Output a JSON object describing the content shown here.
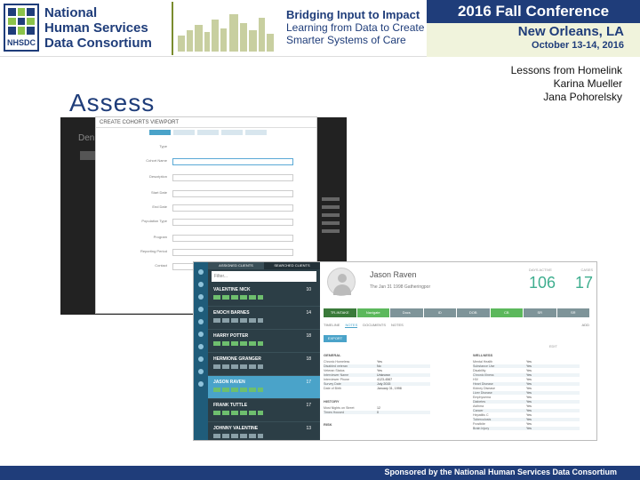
{
  "header": {
    "org_line1": "National",
    "org_line2": "Human Services",
    "org_line3": "Data Consortium",
    "logo_abbr": "NHSDC",
    "theme_title": "Bridging Input to Impact",
    "theme_line2": "Learning from Data to Create",
    "theme_line3": "Smarter Systems of Care",
    "conference": "2016 Fall Conference",
    "location": "New Orleans, LA",
    "dates": "October 13-14, 2016"
  },
  "slide": {
    "title": "Assess",
    "subtitle": "Lessons from Homelink",
    "author1": "Karina Mueller",
    "author2": "Jana Pohorelsky"
  },
  "footer": {
    "text": "Sponsored by the National Human Services Data Consortium"
  },
  "bg_screenshot": {
    "heading": "Den"
  },
  "form": {
    "title": "CREATE COHORTS VIEWPORT",
    "fields": [
      {
        "label": "Type"
      },
      {
        "label": "Cohort Name"
      },
      {
        "label": "Description"
      },
      {
        "label": "Start Date"
      },
      {
        "label": "End Date"
      },
      {
        "label": "Population Type"
      },
      {
        "label": "Program"
      },
      {
        "label": "Reporting Period"
      },
      {
        "label": "Contact"
      }
    ]
  },
  "app": {
    "list_tabs": [
      "ASSIGNED CLIENTS",
      "SEARCHED CLIENTS"
    ],
    "filter_placeholder": "Filter...",
    "clients": [
      {
        "name": "VALENTINE NICK",
        "age": "10"
      },
      {
        "name": "ENOCH BARNES",
        "age": "14"
      },
      {
        "name": "HARRY POTTER",
        "age": "18"
      },
      {
        "name": "HERMIONE GRANGER",
        "age": "18"
      },
      {
        "name": "JASON RAVEN",
        "age": "17"
      },
      {
        "name": "FRANK TUTTLE",
        "age": "17"
      },
      {
        "name": "JOHNNY VALENTINE",
        "age": "13"
      }
    ],
    "profile": {
      "name": "Jason Raven",
      "meta": "The Jan 31 1998   Gatheringpor",
      "stat_label1": "DAYS ACTIVE",
      "stat_label2": "CASES",
      "stat_value1": "106",
      "stat_value2": "17",
      "path_steps": [
        "TR-INTAKE",
        "Navigate",
        "Docs",
        "ID",
        "DOB",
        "CB",
        "SR",
        "SR"
      ],
      "sub_tabs": [
        "TIMELINE",
        "NOTES",
        "DOCUMENTS",
        "NOTES"
      ],
      "add_label": "ADD",
      "export_label": "EXPORT",
      "edit_label": "EDIT",
      "general_heading": "GENERAL",
      "general": [
        {
          "k": "Chronic Homeless",
          "v": "Yes"
        },
        {
          "k": "Disabled veteran",
          "v": "No"
        },
        {
          "k": "Veteran Status",
          "v": "Yes"
        },
        {
          "k": "Interviewer Name",
          "v": "Unknown"
        },
        {
          "k": "Interviewer Phone",
          "v": "4123-4567"
        },
        {
          "k": "Survey Date",
          "v": "July 2015"
        },
        {
          "k": "Date of Birth",
          "v": "January 31, 1998"
        }
      ],
      "history_heading": "HISTORY",
      "history": [
        {
          "k": "Most Nights on Street",
          "v": "12"
        },
        {
          "k": "Times Housed",
          "v": "0"
        }
      ],
      "risk_heading": "RISK",
      "wellness_heading": "WELLNESS",
      "wellness": [
        {
          "k": "Mental Health",
          "v": "Yes"
        },
        {
          "k": "Substance Use",
          "v": "Yes"
        },
        {
          "k": "Disability",
          "v": "Yes"
        },
        {
          "k": "Chronic Illness",
          "v": "Yes"
        },
        {
          "k": "HIV",
          "v": "Yes"
        },
        {
          "k": "Heart Disease",
          "v": "Yes"
        },
        {
          "k": "Kidney Disease",
          "v": "Yes"
        },
        {
          "k": "Liver Disease",
          "v": "Yes"
        },
        {
          "k": "Emphysema",
          "v": "Yes"
        },
        {
          "k": "Diabetes",
          "v": "Yes"
        },
        {
          "k": "Asthma",
          "v": "Yes"
        },
        {
          "k": "Cancer",
          "v": "Yes"
        },
        {
          "k": "Hepatitis C",
          "v": "Yes"
        },
        {
          "k": "Tuberculosis",
          "v": "Yes"
        },
        {
          "k": "Frostbite",
          "v": "Yes"
        },
        {
          "k": "Brain Injury",
          "v": "Yes"
        }
      ]
    }
  }
}
